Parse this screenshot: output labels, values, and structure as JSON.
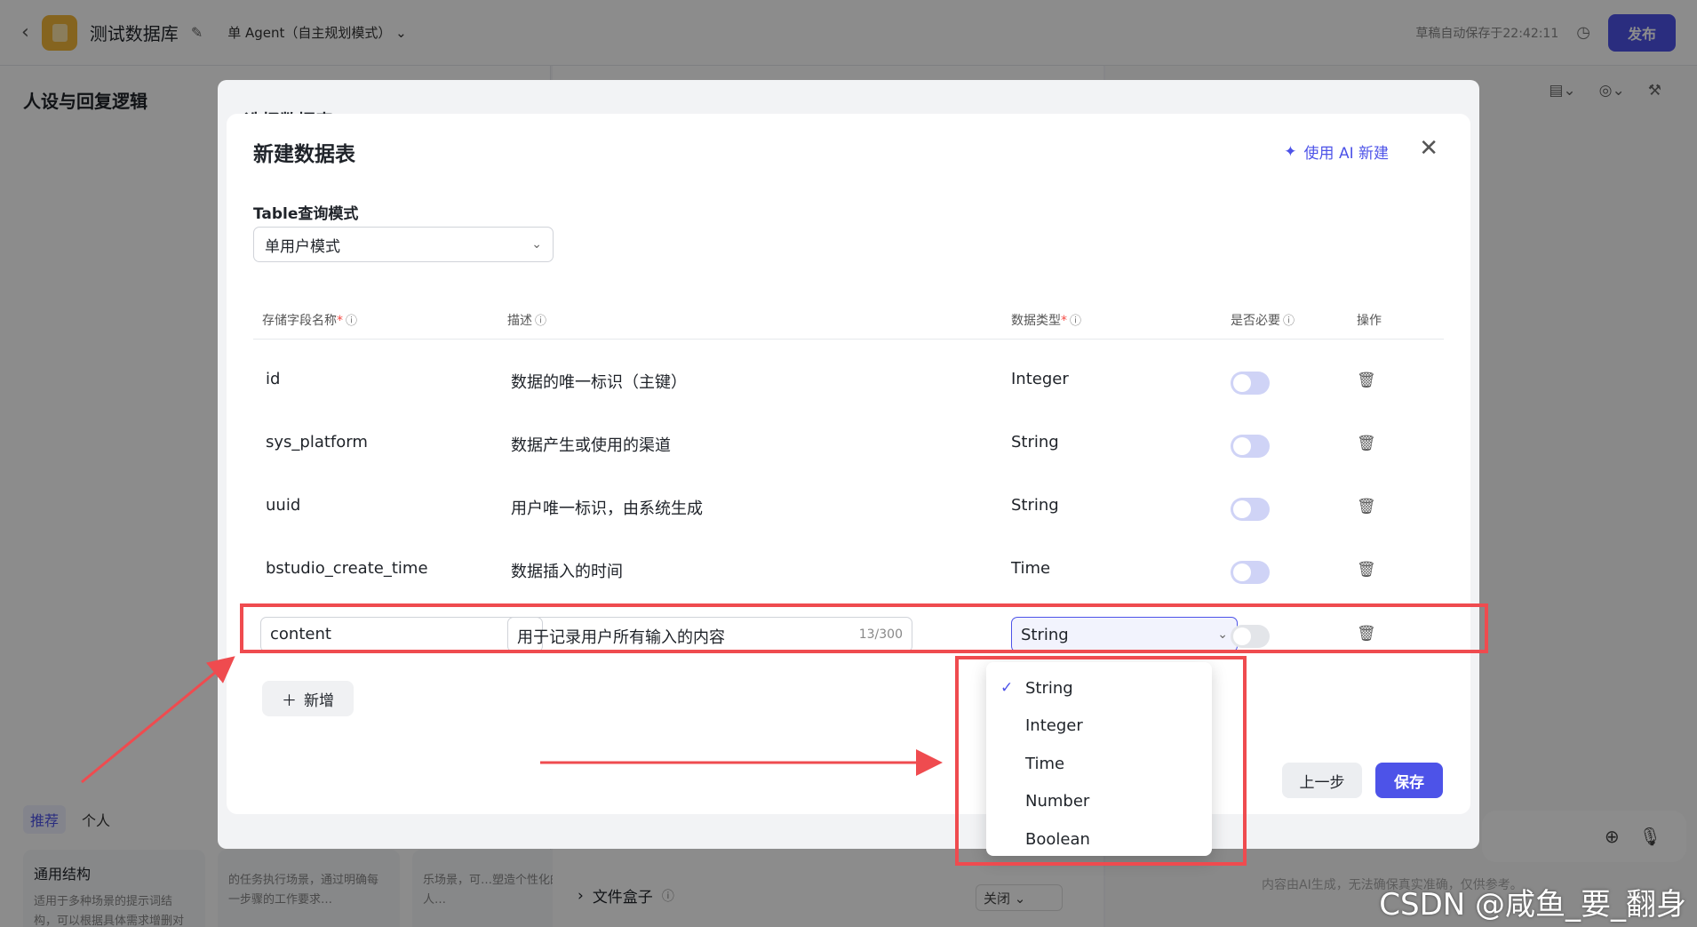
{
  "app": {
    "name": "测试数据库",
    "agent_mode": "单 Agent（自主规划模式）",
    "autosave": "草稿自动保存于22:42:11",
    "publish": "发布"
  },
  "left_panel": {
    "title": "人设与回复逻辑",
    "tabs": [
      "推荐",
      "个人"
    ],
    "cards": [
      {
        "title": "通用结构",
        "desc": "适用于多种场景的提示词结构，可以根据具体需求增删对应模块"
      },
      {
        "title": "",
        "desc": "的任务执行场景，通过明确每一步骤的工作要求…"
      },
      {
        "title": "",
        "desc": "乐场景，可…塑造个性化的人…"
      }
    ]
  },
  "mid_panel": {
    "file_box": "文件盒子",
    "close_select": "关闭"
  },
  "right_panel": {
    "disclaimer": "内容由AI生成，无法确保真实准确，仅供参考。"
  },
  "back_dialog": {
    "title": "选择数据表"
  },
  "modal": {
    "title": "新建数据表",
    "ai_button": "使用 AI 新建",
    "mode_label": "Table查询模式",
    "mode_value": "单用户模式",
    "columns": [
      "存储字段名称",
      "描述",
      "数据类型",
      "是否必要",
      "操作"
    ],
    "rows": [
      {
        "name": "id",
        "desc": "数据的唯一标识（主键）",
        "type": "Integer"
      },
      {
        "name": "sys_platform",
        "desc": "数据产生或使用的渠道",
        "type": "String"
      },
      {
        "name": "uuid",
        "desc": "用户唯一标识，由系统生成",
        "type": "String"
      },
      {
        "name": "bstudio_create_time",
        "desc": "数据插入的时间",
        "type": "Time"
      }
    ],
    "edit_row": {
      "name": "content",
      "desc": "用于记录用户所有输入的内容",
      "counter": "13/300",
      "type": "String"
    },
    "add_button": "新增",
    "prev_button": "上一步",
    "save_button": "保存",
    "type_options": [
      "String",
      "Integer",
      "Time",
      "Number",
      "Boolean"
    ],
    "selected_type": "String"
  },
  "watermark": "CSDN @咸鱼_要_翻身",
  "colors": {
    "accent": "#4d53e8",
    "annotation": "#ef4b4f"
  }
}
